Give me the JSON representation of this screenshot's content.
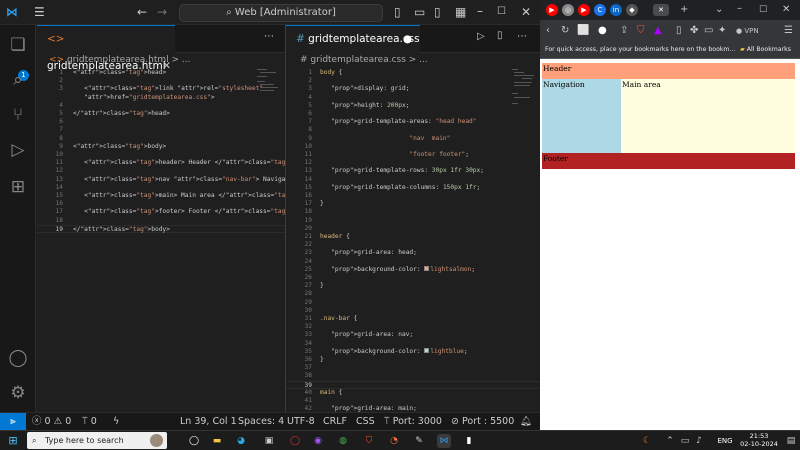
{
  "vscode": {
    "command_center": "Web [Administrator]",
    "activity_badge": "1",
    "html_tab": "gridtemplatearea.html",
    "css_tab": "gridtemplatearea.css",
    "html_breadcrumb": "gridtemplatearea.html > ...",
    "css_breadcrumb": "# gridtemplatearea.css > ...",
    "html_lines": [
      {
        "n": "1",
        "t": "<head>"
      },
      {
        "n": "2",
        "t": ""
      },
      {
        "n": "3",
        "t": "   <link rel=\"stylesheet\""
      },
      {
        "n": "",
        "t": "   href=\"gridtemplatearea.css\">"
      },
      {
        "n": "4",
        "t": ""
      },
      {
        "n": "5",
        "t": "</head>"
      },
      {
        "n": "6",
        "t": ""
      },
      {
        "n": "7",
        "t": ""
      },
      {
        "n": "8",
        "t": ""
      },
      {
        "n": "9",
        "t": "<body>"
      },
      {
        "n": "10",
        "t": ""
      },
      {
        "n": "11",
        "t": "   <header> Header </header>"
      },
      {
        "n": "12",
        "t": ""
      },
      {
        "n": "13",
        "t": "   <nav class=\"nav-bar\"> Navigation </nav>"
      },
      {
        "n": "14",
        "t": ""
      },
      {
        "n": "15",
        "t": "   <main> Main area </main>"
      },
      {
        "n": "16",
        "t": ""
      },
      {
        "n": "17",
        "t": "   <footer> Footer </footer>"
      },
      {
        "n": "18",
        "t": ""
      },
      {
        "n": "19",
        "t": "</body>"
      }
    ],
    "css_lines": [
      {
        "n": "1",
        "t": "body {"
      },
      {
        "n": "2",
        "t": ""
      },
      {
        "n": "3",
        "t": "   display: grid;"
      },
      {
        "n": "4",
        "t": ""
      },
      {
        "n": "5",
        "t": "   height: 200px;"
      },
      {
        "n": "6",
        "t": ""
      },
      {
        "n": "7",
        "t": "   grid-template-areas: \"head head\""
      },
      {
        "n": "8",
        "t": ""
      },
      {
        "n": "9",
        "t": "                        \"nav  main\""
      },
      {
        "n": "10",
        "t": ""
      },
      {
        "n": "11",
        "t": "                        \"footer footer\";"
      },
      {
        "n": "12",
        "t": ""
      },
      {
        "n": "13",
        "t": "   grid-template-rows: 30px 1fr 30px;"
      },
      {
        "n": "14",
        "t": ""
      },
      {
        "n": "15",
        "t": "   grid-template-columns: 150px 1fr;"
      },
      {
        "n": "16",
        "t": ""
      },
      {
        "n": "17",
        "t": "}"
      },
      {
        "n": "18",
        "t": ""
      },
      {
        "n": "19",
        "t": ""
      },
      {
        "n": "20",
        "t": ""
      },
      {
        "n": "21",
        "t": "header {"
      },
      {
        "n": "22",
        "t": ""
      },
      {
        "n": "23",
        "t": "   grid-area: head;"
      },
      {
        "n": "24",
        "t": ""
      },
      {
        "n": "25",
        "t": "   background-color: lightsalmon;"
      },
      {
        "n": "26",
        "t": ""
      },
      {
        "n": "27",
        "t": "}"
      },
      {
        "n": "28",
        "t": ""
      },
      {
        "n": "29",
        "t": ""
      },
      {
        "n": "30",
        "t": ""
      },
      {
        "n": "31",
        "t": ".nav-bar {"
      },
      {
        "n": "32",
        "t": ""
      },
      {
        "n": "33",
        "t": "   grid-area: nav;"
      },
      {
        "n": "34",
        "t": ""
      },
      {
        "n": "35",
        "t": "   background-color: lightblue;"
      },
      {
        "n": "36",
        "t": "}"
      },
      {
        "n": "37",
        "t": ""
      },
      {
        "n": "38",
        "t": ""
      },
      {
        "n": "39",
        "t": ""
      },
      {
        "n": "40",
        "t": "main {"
      },
      {
        "n": "41",
        "t": ""
      },
      {
        "n": "42",
        "t": "   grid-area: main;"
      }
    ],
    "status": {
      "errors": "0",
      "warnings": "0",
      "ports": "0",
      "position": "Ln 39, Col 1",
      "spaces": "Spaces: 4",
      "encoding": "UTF-8",
      "eol": "CRLF",
      "language": "CSS",
      "port1": "Port: 3000",
      "port2": "Port : 5500"
    }
  },
  "browser": {
    "bookmarks_hint": "For quick access, place your bookmarks here on the bookm...",
    "all_bookmarks": "All Bookmarks",
    "vpn": "VPN",
    "page": {
      "header": "Header",
      "nav": "Navigation",
      "main": "Main area",
      "footer": "Footer"
    },
    "colors": {
      "header": "#ffa07a",
      "nav": "#add8e6",
      "main": "#ffffe0",
      "footer": "#b22222"
    }
  },
  "taskbar": {
    "search_placeholder": "Type here to search",
    "lang": "ENG",
    "time": "21:53",
    "date": "02-10-2024"
  }
}
